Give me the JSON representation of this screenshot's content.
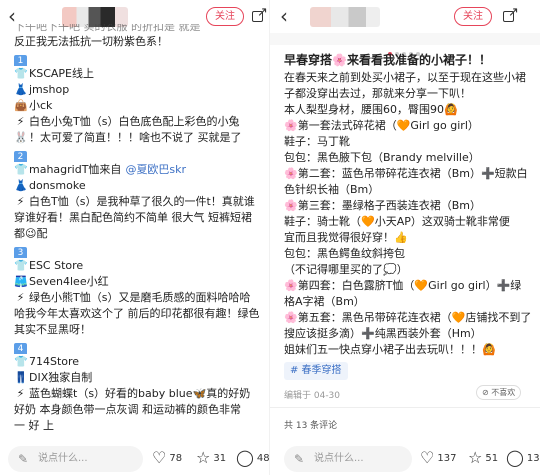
{
  "left": {
    "follow_label": "关注",
    "top_line": "下午吧下午吧 实的衣服 的折扣是 就是",
    "lines": [
      {
        "kind": "text",
        "text": "反正我无法抵抗一切粉紫色系！"
      },
      {
        "kind": "num",
        "text": "1"
      },
      {
        "kind": "item",
        "icon": "👕",
        "text": "KSCAPE线上"
      },
      {
        "kind": "item",
        "icon": "👗",
        "text": "jmshop"
      },
      {
        "kind": "item",
        "icon": "👜",
        "text": "小ck"
      },
      {
        "kind": "item",
        "icon": "⚡",
        "text": "白色小兔T恤（s）白色底色配上彩色的小兔"
      },
      {
        "kind": "item",
        "icon": "🐰",
        "text": "！太可爱了简直！！！啥也不说了 买就是了"
      },
      {
        "kind": "num",
        "text": "2"
      },
      {
        "kind": "item",
        "icon": "👕",
        "text": "mahagridT恤来自",
        "extra": "@夏欧巴skr"
      },
      {
        "kind": "item",
        "icon": "👗",
        "text": "donsmoke"
      },
      {
        "kind": "item",
        "icon": "⚡",
        "text": "白色T恤（s）是我种草了很久的一件t！真就谁"
      },
      {
        "kind": "text",
        "text": "穿谁好看！黑白配色简约不简单 很大气 短裤短裙"
      },
      {
        "kind": "text",
        "text": "都😉配"
      },
      {
        "kind": "num",
        "text": "3"
      },
      {
        "kind": "item",
        "icon": "👕",
        "text": "ESC Store"
      },
      {
        "kind": "item",
        "icon": "🩳",
        "text": "Seven4lee小红"
      },
      {
        "kind": "item",
        "icon": "⚡",
        "text": "绿色小熊T恤（s）又是磨毛质感的面料哈哈哈"
      },
      {
        "kind": "text",
        "text": "哈我今年太喜欢这个了 前后的印花都很有趣！绿色"
      },
      {
        "kind": "text",
        "text": "其实不显黑呀！"
      },
      {
        "kind": "num",
        "text": "4"
      },
      {
        "kind": "item",
        "icon": "👕",
        "text": "714Store"
      },
      {
        "kind": "item",
        "icon": "👖",
        "text": "DIX独家自制"
      },
      {
        "kind": "item",
        "icon": "⚡",
        "text": "蓝色蝴蝶t（s）好看的baby blue🦋真的好奶"
      },
      {
        "kind": "text",
        "text": "好奶 本身颜色带一点灰调 和运动裤的颜色非常"
      },
      {
        "kind": "text",
        "text": "一 好 上"
      }
    ],
    "comment_placeholder": "说点什么...",
    "likes": "78",
    "stars": "31",
    "comments": "48"
  },
  "right": {
    "follow_label": "关注",
    "title": "早春穿搭🌸来看看我准备的小裙子！！",
    "lines": [
      "在春天来之前到处买小裙子，以至于现在这些小裙",
      "子都没穿出去过，那就来分享一下叭！",
      "本人梨型身材，腰围60，臀围90🙆",
      "🌸第一套法式碎花裙（🧡Girl go girl）",
      "鞋子：马丁靴",
      "包包：黑色腋下包（Brandy melville）",
      "🌸第二套：蓝色吊带碎花连衣裙（Bm）➕短款白",
      "色针织长袖（Bm）",
      "🌸第三套：墨绿格子西装连衣裙（Bm）",
      "鞋子：骑士靴（🧡小天AP）这双骑士靴非常便",
      "宜而且我觉得很好穿！👍",
      "包包：黑色鳄鱼纹斜挎包",
      "（不记得哪里买的了💭）",
      "🌸第四套：白色露脐T恤（🧡Girl go girl）➕绿",
      "格A字裙（Bm）",
      "🌸第五套：黑色吊带碎花连衣裙（🧡店铺找不到了 搜",
      "搜应该挺多滴）➕纯黑西装外套（Hm）",
      "姐妹们五一快点穿小裙子出去玩叭！！！🙆"
    ],
    "tag": "# 春季穿搭",
    "date": "编辑于 04-30",
    "not_like": "不喜欢",
    "comment_count": "共 13 条评论",
    "comment_placeholder": "说点什么...",
    "likes": "137",
    "stars": "51",
    "comments": "13"
  },
  "colors": {
    "accent": "#e6455a",
    "number_badge": "#5b9ee8",
    "link": "#3b6fc4"
  }
}
